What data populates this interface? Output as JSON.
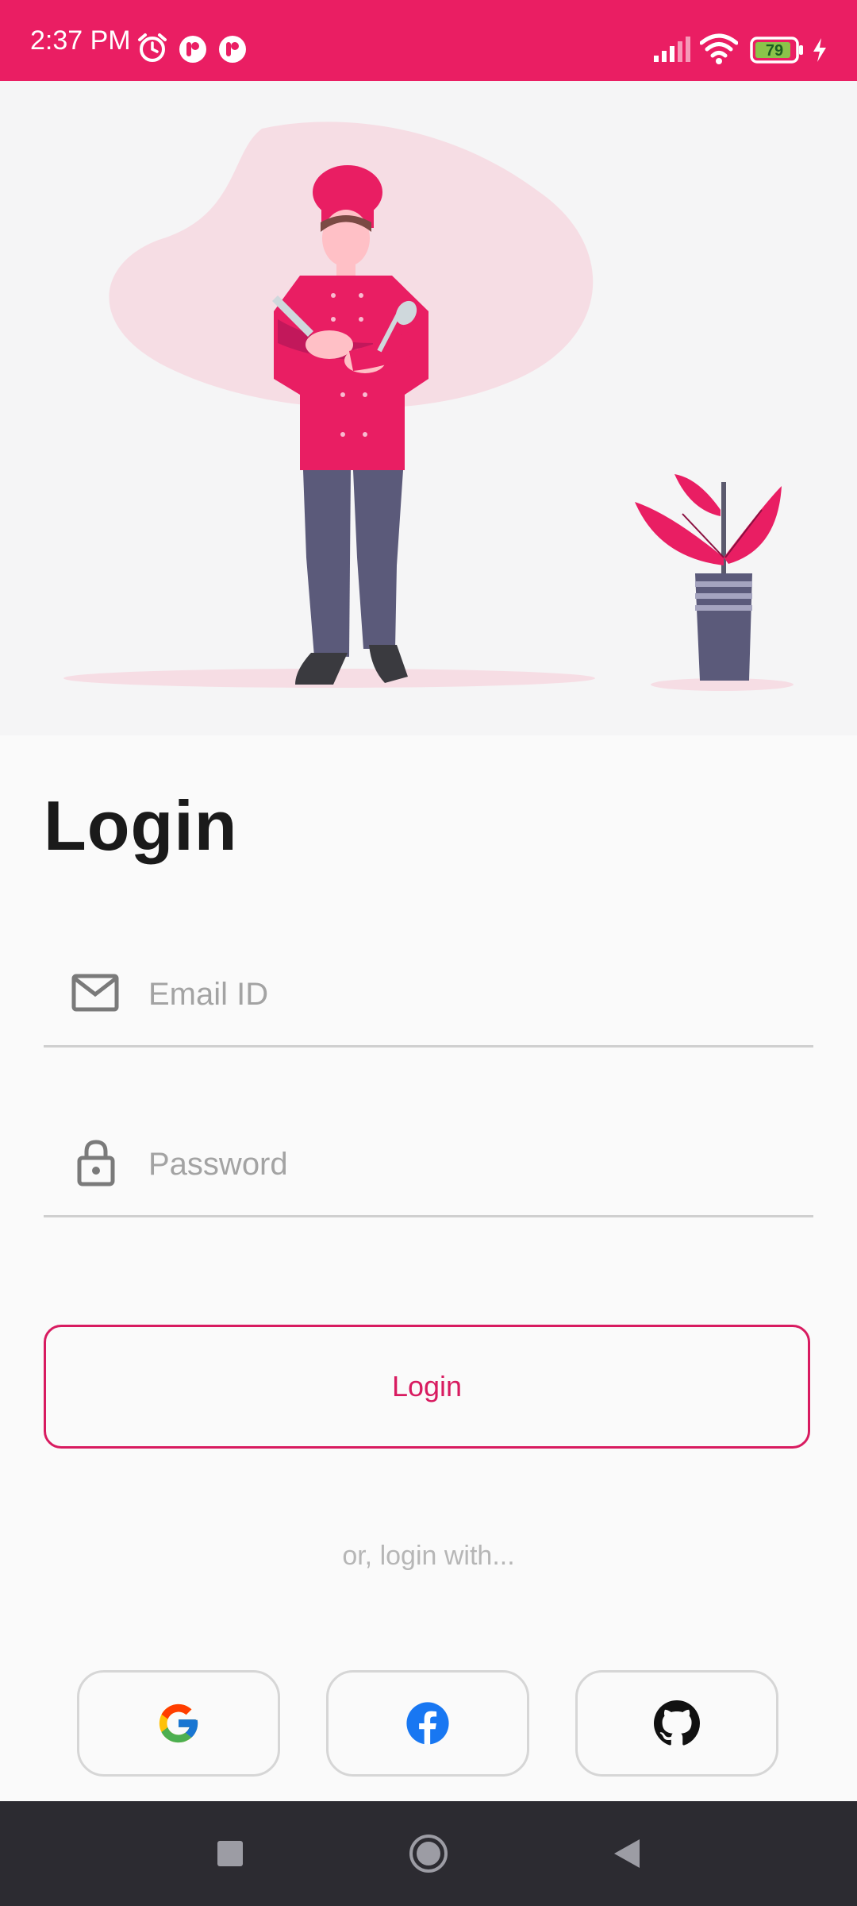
{
  "status_bar": {
    "time": "2:37 PM",
    "battery_level": "79",
    "icons": [
      "alarm-icon",
      "app-notification-icon",
      "app-notification-icon",
      "signal-icon",
      "wifi-icon",
      "battery-icon",
      "charging-icon"
    ]
  },
  "illustration": {
    "description_icon": "chef-illustration",
    "accent_color": "#e91e63"
  },
  "login_form": {
    "title": "Login",
    "email": {
      "placeholder": "Email ID",
      "value": "",
      "icon": "mail-icon"
    },
    "password": {
      "placeholder": "Password",
      "value": "",
      "icon": "lock-icon"
    },
    "login_button_label": "Login",
    "alt_login_text": "or, login with...",
    "social_buttons": [
      {
        "name": "google",
        "icon": "google-icon"
      },
      {
        "name": "facebook",
        "icon": "facebook-icon"
      },
      {
        "name": "github",
        "icon": "github-icon"
      }
    ]
  },
  "nav_bar": {
    "buttons": [
      "recents-icon",
      "home-icon",
      "back-icon"
    ]
  },
  "colors": {
    "status_bar": "#ea1e63",
    "accent": "#d81b60",
    "background": "#fafafa",
    "nav_bar": "#2c2b31"
  }
}
